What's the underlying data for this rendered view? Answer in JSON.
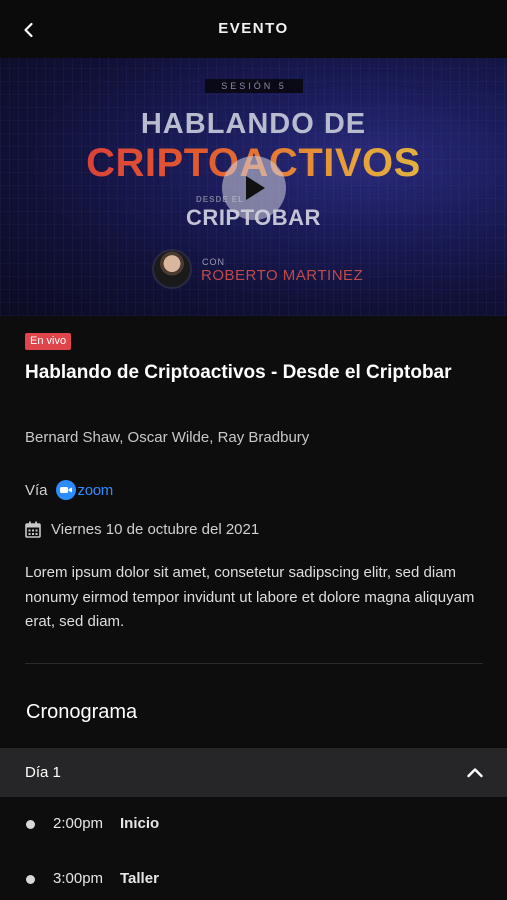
{
  "header": {
    "title": "EVENTO",
    "back_icon": "chevron-left-icon"
  },
  "banner": {
    "session": "SESIÓN 5",
    "line1": "HABLANDO DE",
    "line2": "CRIPTOACTIVOS",
    "desde": "DESDE EL",
    "line3": "CRIPTOBAR",
    "speaker_prefix": "CON",
    "speaker_name": "ROBERTO MARTINEZ",
    "play_icon": "play-icon"
  },
  "event": {
    "badge": "En vivo",
    "title": "Hablando de Criptoactivos - Desde el Criptobar",
    "speakers": "Bernard Shaw, Oscar Wilde, Ray Bradbury",
    "via_label": "Vía",
    "platform": "zoom",
    "date": "Viernes 10 de octubre del 2021",
    "description": "Lorem ipsum dolor sit amet, consetetur sadipscing elitr, sed diam nonumy eirmod tempor invidunt ut labore et dolore magna aliquyam erat, sed diam."
  },
  "schedule": {
    "title": "Cronograma",
    "day_label": "Día 1",
    "items": [
      {
        "time": "2:00pm",
        "name": "Inicio"
      },
      {
        "time": "3:00pm",
        "name": "Taller"
      }
    ]
  },
  "colors": {
    "background": "#0d0d0e",
    "live_badge": "#e0454b",
    "zoom_blue": "#2d8cff",
    "day_header": "#262628"
  }
}
